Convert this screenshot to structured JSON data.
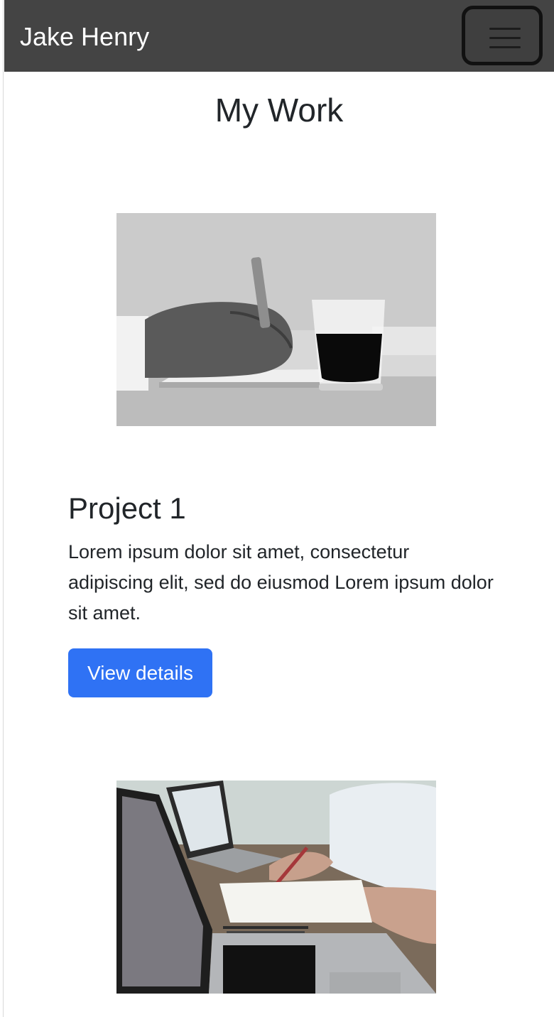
{
  "navbar": {
    "brand": "Jake Henry",
    "toggler_icon": "hamburger-menu-icon",
    "background": "#444444"
  },
  "main": {
    "section_title": "My Work",
    "projects": [
      {
        "image_desc": "Grayscale photo of a hand writing with a pen beside a glass of coffee",
        "title": "Project 1",
        "text": "Lorem ipsum dolor sit amet, consectetur adipiscing elit, sed do eiusmod Lorem ipsum dolor sit amet.",
        "button_label": "View details"
      },
      {
        "image_desc": "Photo of people working with laptops and paper documents on a wooden desk"
      }
    ]
  },
  "colors": {
    "accent": "#2f72f4",
    "text": "#212529"
  }
}
